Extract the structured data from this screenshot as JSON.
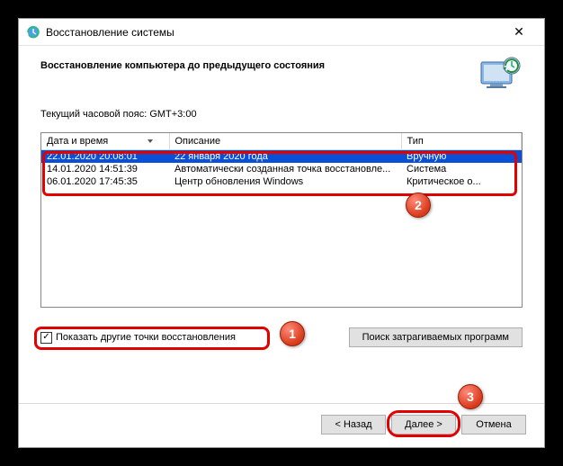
{
  "window": {
    "title": "Восстановление системы"
  },
  "header": {
    "heading": "Восстановление компьютера до предыдущего состояния"
  },
  "timezone_label": "Текущий часовой пояс: GMT+3:00",
  "table": {
    "columns": {
      "date": "Дата и время",
      "desc": "Описание",
      "type": "Тип"
    },
    "rows": [
      {
        "date": "22.01.2020 20:08:01",
        "desc": "22 января 2020 года",
        "type": "Вручную",
        "selected": true
      },
      {
        "date": "14.01.2020 14:51:39",
        "desc": "Автоматически созданная точка восстановле...",
        "type": "Система",
        "selected": false
      },
      {
        "date": "06.01.2020 17:45:35",
        "desc": "Центр обновления Windows",
        "type": "Критическое о...",
        "selected": false
      }
    ]
  },
  "checkbox": {
    "label": "Показать другие точки восстановления",
    "checked": true
  },
  "buttons": {
    "affected": "Поиск затрагиваемых программ",
    "back": "< Назад",
    "next": "Далее >",
    "cancel": "Отмена"
  },
  "markers": {
    "m1": "1",
    "m2": "2",
    "m3": "3"
  }
}
